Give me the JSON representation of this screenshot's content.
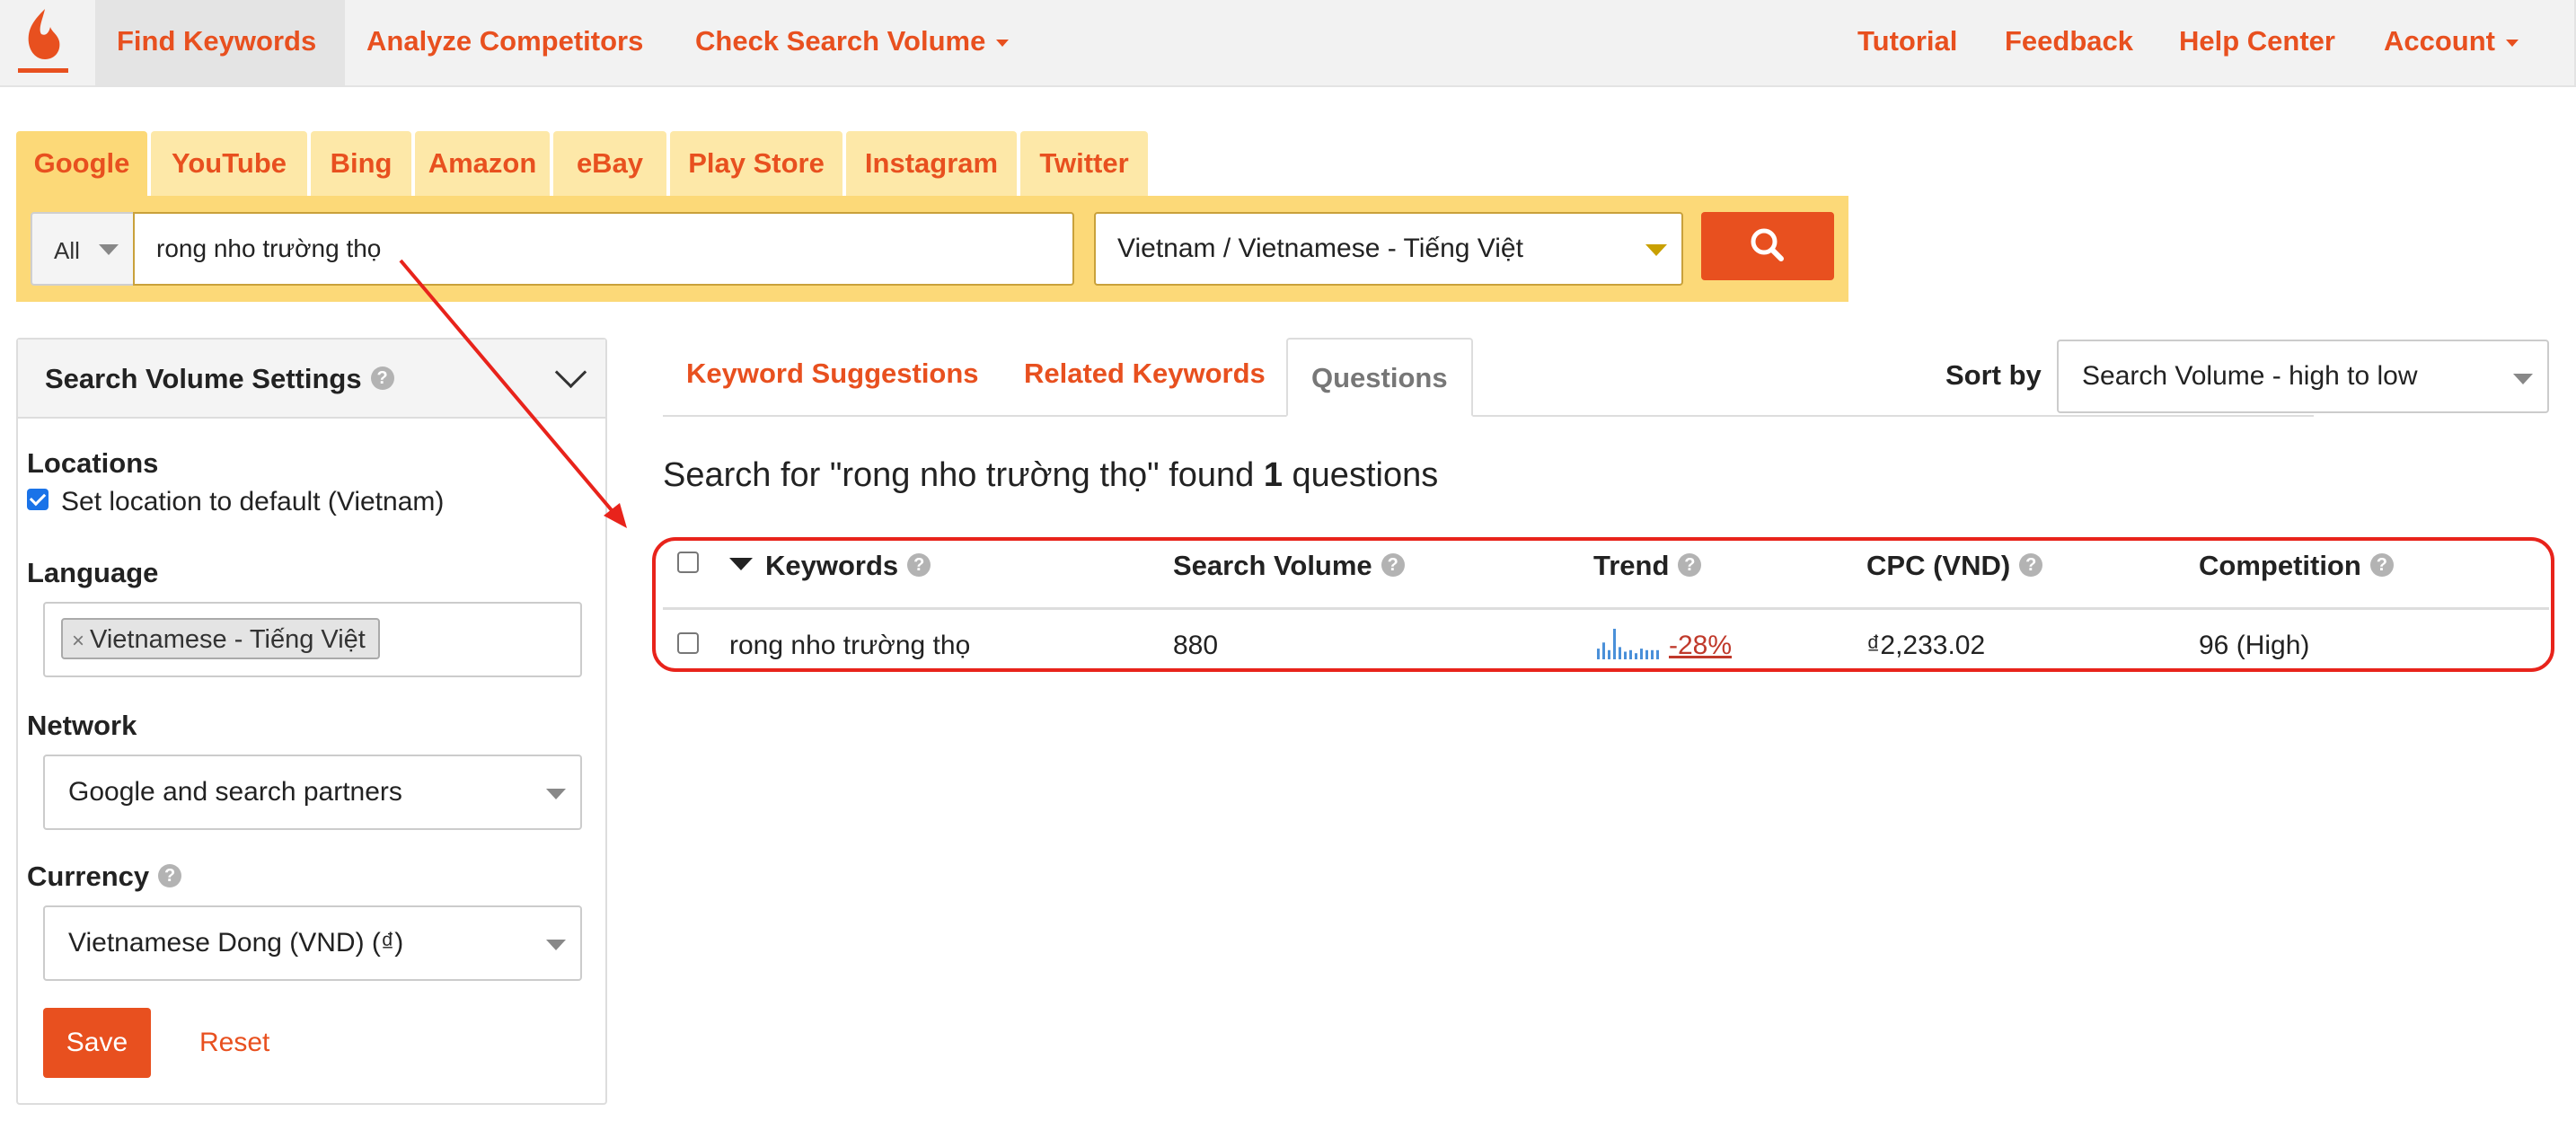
{
  "nav": {
    "logo_icon": "flame-logo",
    "left_items": [
      "Find Keywords",
      "Analyze Competitors",
      "Check Search Volume"
    ],
    "right_items": [
      "Tutorial",
      "Feedback",
      "Help Center",
      "Account"
    ],
    "active": "Find Keywords"
  },
  "sources": {
    "tabs": [
      "Google",
      "YouTube",
      "Bing",
      "Amazon",
      "eBay",
      "Play Store",
      "Instagram",
      "Twitter"
    ],
    "active": "Google"
  },
  "search": {
    "type_value": "All",
    "query": "rong nho trường thọ",
    "language_value": "Vietnam / Vietnamese - Tiếng Việt",
    "button_icon": "search-icon"
  },
  "settings": {
    "title": "Search Volume Settings",
    "locations_label": "Locations",
    "location_checkbox_label": "Set location to default (Vietnam)",
    "location_checked": true,
    "language_label": "Language",
    "language_tag": "Vietnamese - Tiếng Việt",
    "network_label": "Network",
    "network_value": "Google and search partners",
    "currency_label": "Currency",
    "currency_value": "Vietnamese Dong (VND) (₫)",
    "save_label": "Save",
    "reset_label": "Reset"
  },
  "results": {
    "tabs": [
      "Keyword Suggestions",
      "Related Keywords",
      "Questions"
    ],
    "active_tab": "Questions",
    "sort_label": "Sort by",
    "sort_value": "Search Volume - high to low",
    "summary_prefix": "Search for \"rong nho trường thọ\" found ",
    "summary_count": "1",
    "summary_suffix": " questions",
    "columns": [
      "Keywords",
      "Search Volume",
      "Trend",
      "CPC (VND)",
      "Competition"
    ],
    "rows": [
      {
        "keyword": "rong nho trường thọ",
        "search_volume": "880",
        "trend": "-28%",
        "trend_bars": [
          0.35,
          0.55,
          0.3,
          1.0,
          0.4,
          0.25,
          0.3,
          0.2,
          0.35,
          0.3,
          0.3,
          0.3
        ],
        "cpc": "₫2,233.02",
        "competition": "96 (High)"
      }
    ]
  },
  "colors": {
    "brand": "#e8501f",
    "tab_bg": "#fde8a8",
    "search_bar_bg": "#fcd978",
    "annotation": "#e8231b",
    "trend_bar": "#4a90d9"
  }
}
